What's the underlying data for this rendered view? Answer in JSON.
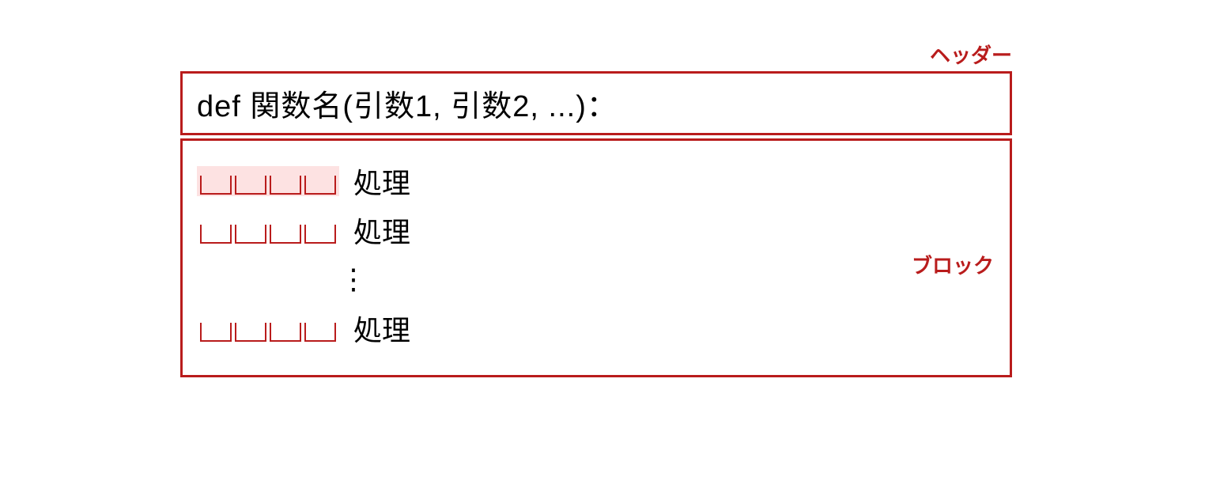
{
  "labels": {
    "header": "ヘッダー",
    "block": "ブロック"
  },
  "header_code": "def 関数名(引数1, 引数2, ...)：",
  "block_lines": [
    {
      "text": "処理",
      "highlighted": true
    },
    {
      "text": "処理",
      "highlighted": false
    },
    {
      "vdots": true
    },
    {
      "text": "処理",
      "highlighted": false
    }
  ],
  "indent_count": 4,
  "colors": {
    "accent": "#b91c1c",
    "highlight_bg": "#fde2e2"
  }
}
